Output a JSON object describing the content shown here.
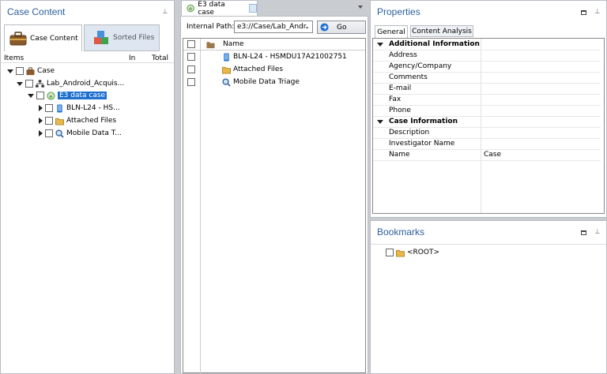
{
  "case_content": {
    "title": "Case Content",
    "tab_case_content": "Case Content",
    "tab_sorted_files": "Sorted Files",
    "col_items": "Items",
    "col_in": "In",
    "col_total": "Total",
    "tree": {
      "case": "Case",
      "lab": "Lab_Android_Acquis...",
      "e3": "E3 data case",
      "bln": "BLN-L24 - HS...",
      "attached": "Attached Files",
      "mobile": "Mobile Data T..."
    }
  },
  "center": {
    "tab_label": "E3 data case",
    "internal_path_label": "Internal Path:",
    "path_value": "e3://Case/Lab_Andr",
    "go_label": "Go",
    "col_name": "Name",
    "rows": [
      "BLN-L24 - HSMDU17A21002751",
      "Attached Files",
      "Mobile Data Triage"
    ]
  },
  "properties": {
    "title": "Properties",
    "tab_general": "General",
    "tab_content_analysis": "Content Analysis",
    "group_additional": "Additional Information",
    "additional_rows": [
      "Address",
      "Agency/Company",
      "Comments",
      "E-mail",
      "Fax",
      "Phone"
    ],
    "group_case": "Case Information",
    "case_rows": [
      "Description",
      "Investigator Name",
      "Name"
    ],
    "name_value": "Case"
  },
  "bookmarks": {
    "title": "Bookmarks",
    "root": "<ROOT>"
  },
  "colors": {
    "title_blue": "#2d5f9a",
    "selection": "#1e6fce",
    "folder": "#e8b84a"
  }
}
